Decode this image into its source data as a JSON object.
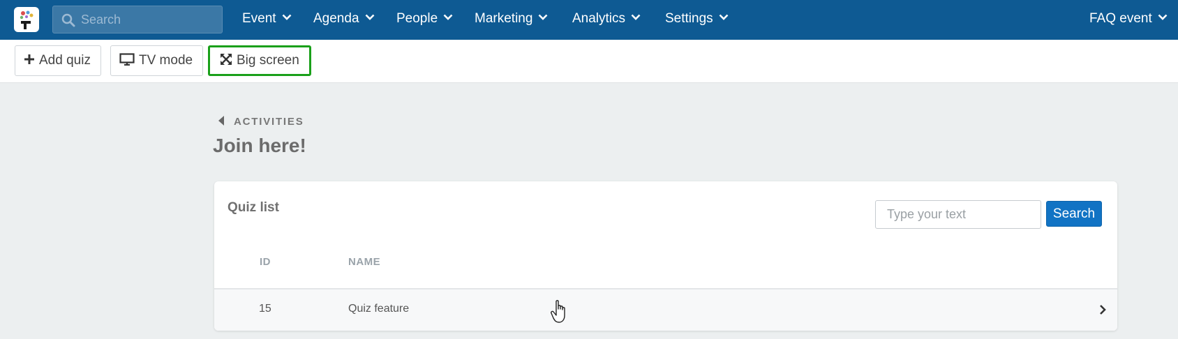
{
  "nav": {
    "search_placeholder": "Search",
    "items": [
      {
        "label": "Event"
      },
      {
        "label": "Agenda"
      },
      {
        "label": "People"
      },
      {
        "label": "Marketing"
      },
      {
        "label": "Analytics"
      },
      {
        "label": "Settings"
      }
    ],
    "event_selector": "FAQ event"
  },
  "toolbar": {
    "add_quiz": "Add quiz",
    "tv_mode": "TV mode",
    "big_screen": "Big screen"
  },
  "breadcrumb": "ACTIVITIES",
  "page_title": "Join here!",
  "quiz_list": {
    "title": "Quiz list",
    "search_placeholder": "Type your text",
    "search_button": "Search",
    "columns": [
      "ID",
      "NAME"
    ],
    "rows": [
      {
        "id": "15",
        "name": "Quiz feature"
      }
    ]
  },
  "colors": {
    "nav_background": "#0e5a93",
    "primary_button": "#1173c4",
    "highlight_border": "#1aa01a",
    "page_background": "#eceff0"
  },
  "icons": {
    "logo": "app-logo",
    "search": "search-icon",
    "add": "plus-icon",
    "tv": "monitor-icon",
    "big_screen": "expand-icon",
    "nav_chevron": "chevron-down-icon",
    "row_arrow": "chevron-right-icon",
    "back": "caret-left-icon"
  }
}
